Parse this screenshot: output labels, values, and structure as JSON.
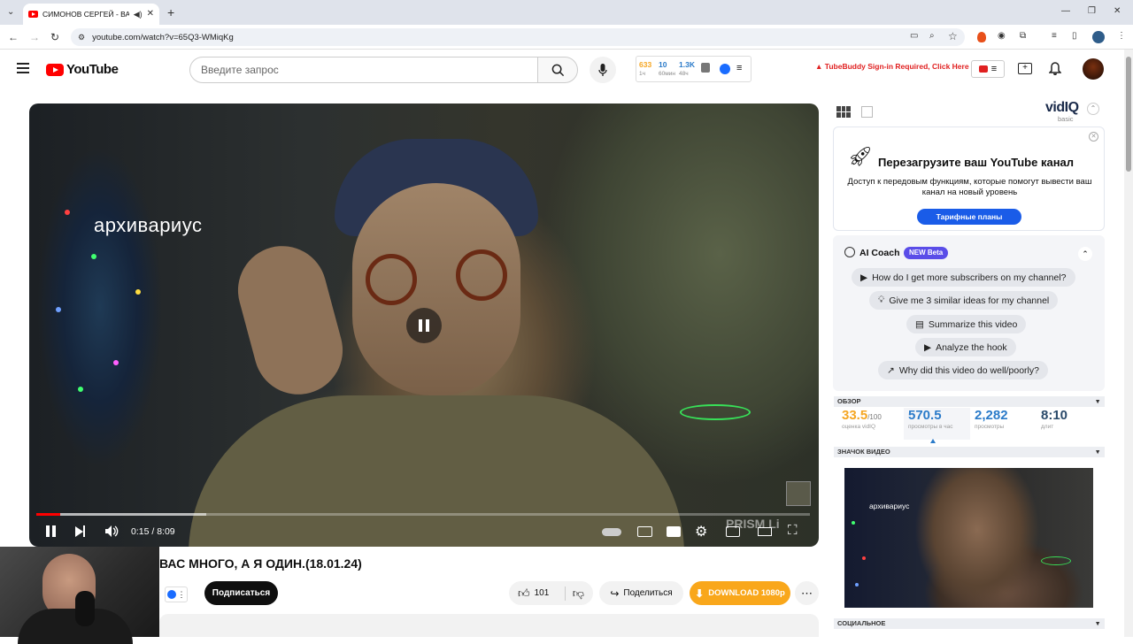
{
  "browser": {
    "tab_title": "СИМОНОВ СЕРГЕЙ - ВАС",
    "url": "youtube.com/watch?v=65Q3-WMiqKg"
  },
  "youtube": {
    "logo_text": "YouTube",
    "search_placeholder": "Введите запрос",
    "video_stats": {
      "views_1h": "633",
      "views_1h_label": "1ч",
      "views_60m": "10",
      "views_60m_label": "60мин",
      "views_48h": "1.3K",
      "views_48h_label": "48ч"
    },
    "tubebuddy_alert": "TubeBuddy Sign-in Required, Click Here"
  },
  "player": {
    "overlay_text": "архивариус",
    "time": "0:15 / 8:09",
    "progress_fraction": 0.031,
    "buffered_fraction": 0.22,
    "watermark": "PRISM Li"
  },
  "video": {
    "title": "ВАС МНОГО, А Я ОДИН.(18.01.24)",
    "subscribe_label": "Подписаться",
    "likes": "101",
    "share_label": "Поделиться",
    "download_label": "DOWNLOAD 1080p"
  },
  "vidiq": {
    "brand": "vidIQ",
    "plan": "basic",
    "promo_title": "Перезагрузите ваш YouTube канал",
    "promo_text": "Доступ к передовым функциям, которые помогут вывести ваш канал на новый уровень",
    "promo_button": "Тарифные планы",
    "coach_title": "AI Coach",
    "coach_badge": "NEW Beta",
    "questions": [
      "How do I get more subscribers on my channel?",
      "Give me 3 similar ideas for my channel",
      "Summarize this video",
      "Analyze the hook",
      "Why did this video do well/poorly?"
    ],
    "overview_label": "ОБЗОР",
    "score": "33.5",
    "score_max": "/100",
    "score_label": "оценка vidIQ",
    "views_per_hour": "570.5",
    "views_per_hour_label": "просмотры в час",
    "views": "2,282",
    "views_label": "просмотры",
    "duration": "8:10",
    "duration_label": "длит",
    "thumbnail_label": "ЗНАЧОК ВИДЕО",
    "thumbnail_overlay": "архивариус",
    "social_label": "СОЦИАЛЬНОЕ"
  },
  "colors": {
    "brand_red": "#ff0000",
    "vidiq_blue": "#1a6cff",
    "download_orange": "#f9a71b",
    "score_orange": "#f5a623",
    "stat_blue": "#2b7bc9"
  }
}
